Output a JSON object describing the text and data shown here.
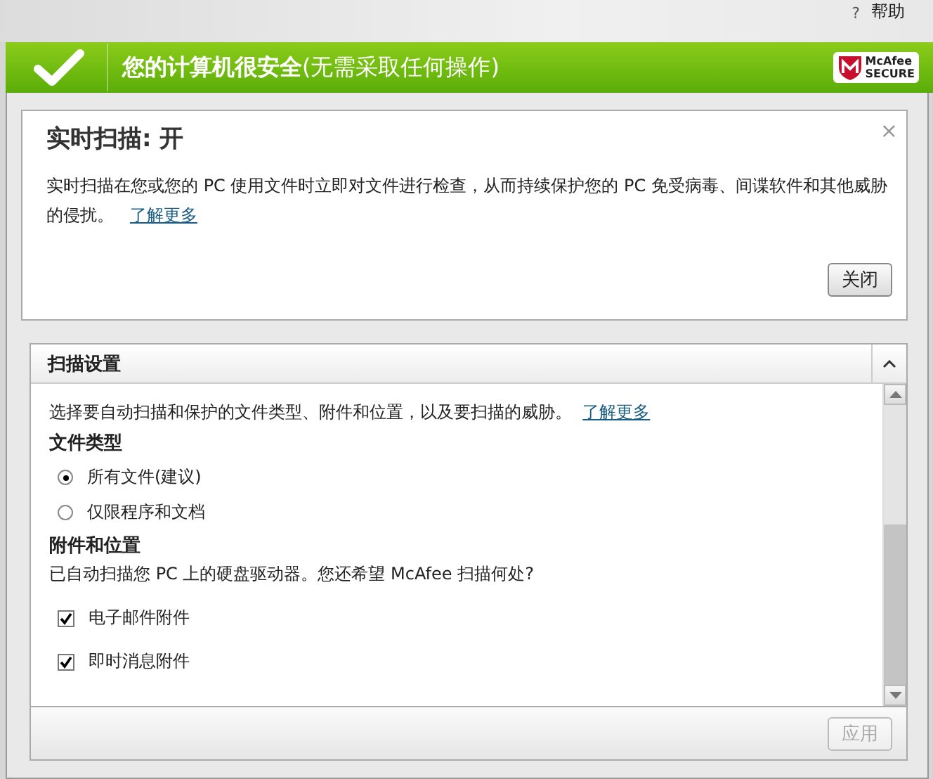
{
  "help": {
    "icon": "?",
    "label": "帮助"
  },
  "banner": {
    "status_bold": "您的计算机很安全",
    "status_rest": "(无需采取任何操作)",
    "badge_line1": "McAfee",
    "badge_line2": "SECURE"
  },
  "info": {
    "title": "实时扫描: 开",
    "close": "×",
    "description": "实时扫描在您或您的 PC 使用文件时立即对文件进行检查，从而持续保护您的 PC 免受病毒、间谍软件和其他威胁的侵扰。",
    "link": "了解更多",
    "button": "关闭"
  },
  "settings": {
    "title": "扫描设置",
    "intro": "选择要自动扫描和保护的文件类型、附件和位置，以及要扫描的威胁。",
    "link": "了解更多",
    "items": [
      {
        "kind": "heading",
        "text": "文件类型"
      },
      {
        "kind": "radio",
        "text": "所有文件(建议)",
        "selected": true
      },
      {
        "kind": "radio",
        "text": "仅限程序和文档",
        "selected": false
      },
      {
        "kind": "heading",
        "text": "附件和位置"
      },
      {
        "kind": "text",
        "text": "已自动扫描您 PC 上的硬盘驱动器。您还希望 McAfee 扫描何处?"
      },
      {
        "kind": "checkbox",
        "text": "电子邮件附件",
        "checked": true
      },
      {
        "kind": "checkbox",
        "text": "即时消息附件",
        "checked": true
      }
    ],
    "apply": {
      "label": "应用",
      "disabled": true
    }
  }
}
